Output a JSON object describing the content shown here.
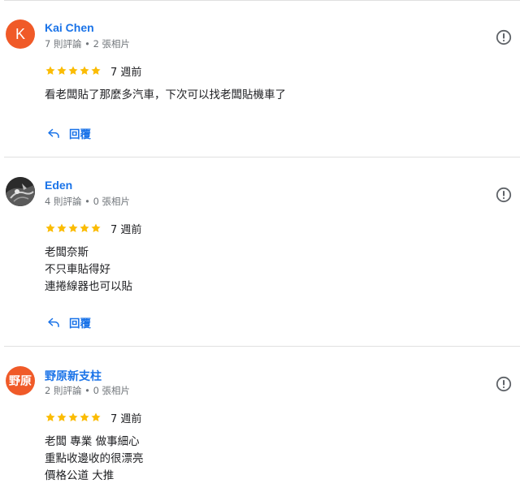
{
  "colors": {
    "accent": "#1a73e8",
    "star": "#fbbc04",
    "avatar_orange": "#f05a28",
    "meta_gray": "#70757a",
    "divider": "#e0e0e0"
  },
  "reviews": [
    {
      "author": "Kai Chen",
      "avatar_letter": "K",
      "meta": "7 則評論 • 2 張相片",
      "rating": 5,
      "time": "7 週前",
      "text_lines": [
        "看老闆貼了那麼多汽車，下次可以找老闆貼機車了"
      ],
      "reply_label": "回覆"
    },
    {
      "author": "Eden",
      "avatar_icon": "profile-photo",
      "meta": "4 則評論 • 0 張相片",
      "rating": 5,
      "time": "7 週前",
      "text_lines": [
        "老闆奈斯",
        "不只車貼得好",
        "連捲線器也可以貼"
      ],
      "reply_label": "回覆"
    },
    {
      "author": "野原新支柱",
      "avatar_letter": "野原",
      "meta": "2 則評論 • 0 張相片",
      "rating": 5,
      "time": "7 週前",
      "text_lines": [
        "老闆 專業 做事細心",
        "重點收邊收的很漂亮",
        "價格公道 大推"
      ]
    }
  ]
}
